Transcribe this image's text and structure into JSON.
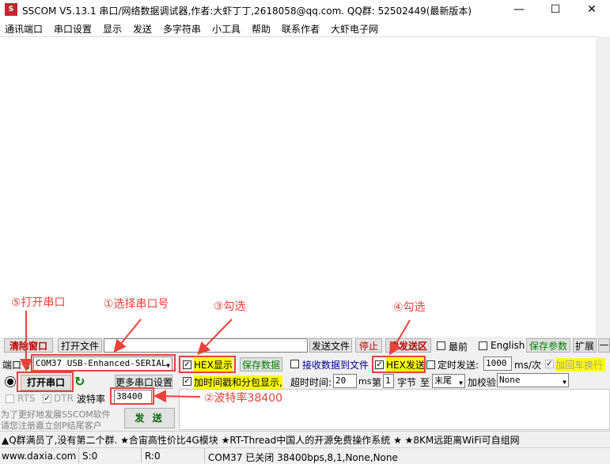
{
  "window": {
    "app_icon": "sscom-icon",
    "title": "SSCOM V5.13.1 串口/网络数据调试器,作者:大虾丁丁,2618058@qq.com. QQ群: 52502449(最新版本)",
    "minimize": "—",
    "maximize": "☐",
    "close": "✕"
  },
  "menu": [
    "通讯端口",
    "串口设置",
    "显示",
    "发送",
    "多字符串",
    "小工具",
    "帮助",
    "联系作者",
    "大虾电子网"
  ],
  "row1": {
    "clear_window": "清除窗口",
    "open_file": "打开文件",
    "file_path": "",
    "send_file": "发送文件",
    "stop": "停止",
    "clear_send": "清发送区",
    "front_most": "最前",
    "english": "English",
    "save_params": "保存参数",
    "expand": "扩展",
    "collapse": "—"
  },
  "row2": {
    "port_label": "端口号",
    "port_value": "COM37 USB-Enhanced-SERIAL C",
    "hex_display": "HEX显示",
    "save_data": "保存数据",
    "recv_to_file": "接收数据到文件",
    "hex_send": "HEX发送",
    "timed_send": "定时发送:",
    "interval": "1000",
    "interval_unit": "ms/次",
    "add_crlf": "加回车换行"
  },
  "row3": {
    "open_port": "打开串口",
    "more_settings": "更多串口设置",
    "timestamp": "加时间戳和分包显示,",
    "timeout_label": "超时时间:",
    "timeout": "20",
    "timeout_unit": "ms",
    "nth_label": "第",
    "nth": "1",
    "byte_label": "字节",
    "to_label": "至",
    "to_value": "末尾",
    "checksum_label": "加校验",
    "checksum_value": "None"
  },
  "row4": {
    "rts": "RTS",
    "dtr": "DTR",
    "baud_label": "波特率",
    "baud_value": "38400"
  },
  "promo": {
    "line1": "为了更好地发展SSCOM软件",
    "line2": "请您注册嘉立创P结尾客户"
  },
  "send_button": "发 送",
  "ticker": "▲Q群满员了,没有第二个群. ★合宙高性价比4G模块 ★RT-Thread中国人的开源免费操作系统 ★ ★8KM远距离WiFi可自组网",
  "status": {
    "website": "www.daxia.com",
    "sent": "S:0",
    "received": "R:0",
    "port_state": "COM37 已关闭  38400bps,8,1,None,None"
  },
  "annotations": {
    "open_port": "⑤打开串口",
    "select_port": "①选择串口号",
    "check_hex_display": "③勾选",
    "check_hex_send": "④勾选",
    "baud": "②波特率38400"
  },
  "colors": {
    "annotation": "#e8423a",
    "highlight": "#ffff00",
    "green_text": "#008000"
  }
}
